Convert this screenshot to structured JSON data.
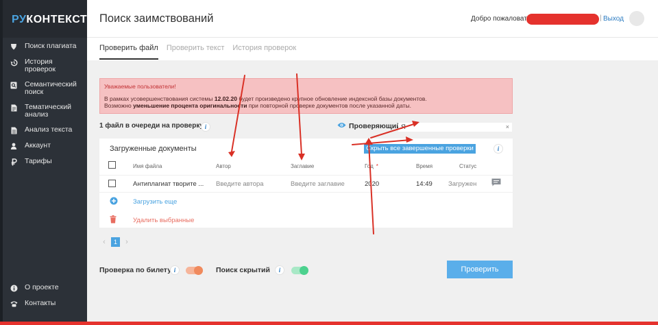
{
  "app": {
    "logo_ru": "РУ",
    "logo_rest": "КОНТЕКСТ"
  },
  "sidebar": {
    "items": [
      {
        "label": "Поиск плагиата",
        "icon": "shield-icon"
      },
      {
        "label": "История проверок",
        "icon": "history-icon"
      },
      {
        "label": "Семантический поиск",
        "icon": "semantic-search-icon"
      },
      {
        "label": "Тематический анализ",
        "icon": "document-icon"
      },
      {
        "label": "Анализ текста",
        "icon": "text-doc-icon"
      },
      {
        "label": "Аккаунт",
        "icon": "user-icon"
      },
      {
        "label": "Тарифы",
        "icon": "ruble-icon"
      }
    ],
    "bottom": [
      {
        "label": "О проекте",
        "icon": "info-icon"
      },
      {
        "label": "Контакты",
        "icon": "phone-icon"
      }
    ]
  },
  "header": {
    "title": "Поиск заимствований",
    "welcome": "Добро пожаловать",
    "separator": "|",
    "logout": "Выход"
  },
  "tabs": [
    {
      "label": "Проверить файл",
      "active": true
    },
    {
      "label": "Проверить текст",
      "active": false
    },
    {
      "label": "История проверок",
      "active": false
    }
  ],
  "alert": {
    "title": "Уважаемые пользователи!",
    "line1_pre": "В рамках усовершенствования системы ",
    "line1_bold": "12.02.20",
    "line1_post": " будет произведено крупное обновление индексной базы документов.",
    "line2_pre": "Возможно ",
    "line2_bold": "уменьшение процента оригинальности",
    "line2_post": " при повторной проверке документов после указанной даты."
  },
  "queue": {
    "text": "1 файл в очереди на проверку",
    "info": "i"
  },
  "reviewer": {
    "label": "Проверяющий",
    "value": "Я",
    "clear": "×"
  },
  "documents": {
    "title": "Загруженные документы",
    "hide_button": "Скрыть все завершенные проверки",
    "info": "i",
    "columns": {
      "name": "Имя файла",
      "author": "Автор",
      "title": "Заглавие",
      "year": "Год",
      "year_required": "*",
      "time": "Время",
      "status": "Статус"
    },
    "rows": [
      {
        "name": "Антиплагиат творите ...",
        "author_placeholder": "Введите автора",
        "title_placeholder": "Введите заглавие",
        "year": "2020",
        "time": "14:49",
        "status": "Загружен"
      }
    ],
    "upload_more": "Загрузить еще",
    "delete_selected": "Удалить выбранные"
  },
  "pagination": {
    "prev": "‹",
    "page": "1",
    "next": "›"
  },
  "options": {
    "ticket_check": {
      "label": "Проверка по билету",
      "info": "i",
      "toggle_on": true,
      "color": "#f08a5d"
    },
    "hidden_search": {
      "label": "Поиск скрытий",
      "info": "i",
      "toggle_on": true,
      "color": "#4cd18e"
    }
  },
  "check_button": "Проверить",
  "colors": {
    "accent": "#4aa3e0",
    "sidebar": "#2c3138",
    "alert_bg": "#f6c1c2",
    "annotation": "#d93025"
  }
}
